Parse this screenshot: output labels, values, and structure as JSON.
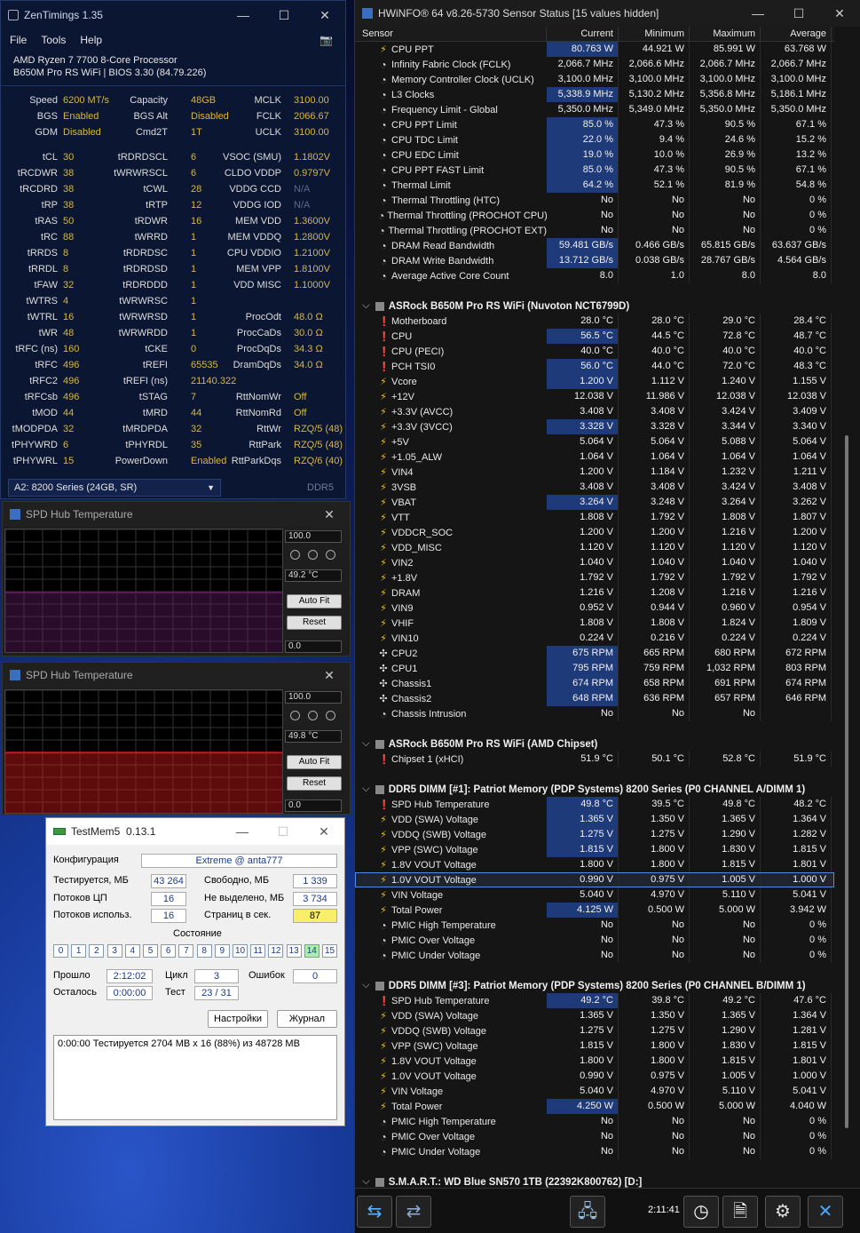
{
  "zt": {
    "title": "ZenTimings 1.35",
    "menu": [
      "File",
      "Tools",
      "Help"
    ],
    "cpu": "AMD Ryzen 7 7700 8-Core Processor",
    "board": "B650M Pro RS WiFi | BIOS 3.30 (84.79.226)",
    "top": [
      [
        "Speed",
        "6200 MT/s",
        "Capacity",
        "48GB",
        "MCLK",
        "3100.00"
      ],
      [
        "BGS",
        "Enabled",
        "BGS Alt",
        "Disabled",
        "FCLK",
        "2066.67"
      ],
      [
        "GDM",
        "Disabled",
        "Cmd2T",
        "1T",
        "UCLK",
        "3100.00"
      ]
    ],
    "timings": [
      [
        "tCL",
        "30",
        "tRDRDSCL",
        "6",
        "VSOC (SMU)",
        "1.1802V"
      ],
      [
        "tRCDWR",
        "38",
        "tWRWRSCL",
        "6",
        "CLDO VDDP",
        "0.9797V"
      ],
      [
        "tRCDRD",
        "38",
        "tCWL",
        "28",
        "VDDG CCD",
        "N/A"
      ],
      [
        "tRP",
        "38",
        "tRTP",
        "12",
        "VDDG IOD",
        "N/A"
      ],
      [
        "tRAS",
        "50",
        "tRDWR",
        "16",
        "MEM VDD",
        "1.3600V"
      ],
      [
        "tRC",
        "88",
        "tWRRD",
        "1",
        "MEM VDDQ",
        "1.2800V"
      ],
      [
        "tRRDS",
        "8",
        "tRDRDSC",
        "1",
        "CPU VDDIO",
        "1.2100V"
      ],
      [
        "tRRDL",
        "8",
        "tRDRDSD",
        "1",
        "MEM VPP",
        "1.8100V"
      ],
      [
        "tFAW",
        "32",
        "tRDRDDD",
        "1",
        "VDD MISC",
        "1.1000V"
      ],
      [
        "tWTRS",
        "4",
        "tWRWRSC",
        "1",
        "",
        ""
      ],
      [
        "tWTRL",
        "16",
        "tWRWRSD",
        "1",
        "ProcOdt",
        "48.0 Ω"
      ],
      [
        "tWR",
        "48",
        "tWRWRDD",
        "1",
        "ProcCaDs",
        "30.0 Ω"
      ],
      [
        "tRFC (ns)",
        "160",
        "tCKE",
        "0",
        "ProcDqDs",
        "34.3 Ω"
      ],
      [
        "tRFC",
        "496",
        "tREFI",
        "65535",
        "DramDqDs",
        "34.0 Ω"
      ],
      [
        "tRFC2",
        "496",
        "tREFI (ns)",
        "21140.322",
        "",
        ""
      ],
      [
        "tRFCsb",
        "496",
        "tSTAG",
        "7",
        "RttNomWr",
        "Off"
      ],
      [
        "tMOD",
        "44",
        "tMRD",
        "44",
        "RttNomRd",
        "Off"
      ],
      [
        "tMODPDA",
        "32",
        "tMRDPDA",
        "32",
        "RttWr",
        "RZQ/5 (48)"
      ],
      [
        "tPHYWRD",
        "6",
        "tPHYRDL",
        "35",
        "RttPark",
        "RZQ/5 (48)"
      ],
      [
        "tPHYWRL",
        "15",
        "PowerDown",
        "Enabled",
        "RttParkDqs",
        "RZQ/6 (40)"
      ]
    ],
    "dimm": "A2: 8200 Series (24GB, SR)",
    "ddr": "DDR5"
  },
  "spd1": {
    "title": "SPD Hub Temperature",
    "max": "100.0",
    "cur": "49.2 °C",
    "min": "0.0",
    "autofit": "Auto Fit",
    "reset": "Reset",
    "level": 0.492
  },
  "spd2": {
    "title": "SPD Hub Temperature",
    "max": "100.0",
    "cur": "49.8 °C",
    "min": "0.0",
    "autofit": "Auto Fit",
    "reset": "Reset",
    "level": 0.498
  },
  "tm": {
    "title": "TestMem5",
    "ver": "0.13.1",
    "cfg_label": "Конфигурация",
    "cfg": "Extreme @ anta777",
    "tested_l": "Тестируется, МБ",
    "tested": "43 264",
    "free_l": "Свободно, МБ",
    "free": "1 339",
    "cpu_l": "Потоков ЦП",
    "cpu": "16",
    "notalloc_l": "Не выделено, МБ",
    "notalloc": "3 734",
    "used_l": "Потоков использ.",
    "used": "16",
    "pages_l": "Страниц в сек.",
    "pages": "87",
    "state": "Состояние",
    "cells": [
      "0",
      "1",
      "2",
      "3",
      "4",
      "5",
      "6",
      "7",
      "8",
      "9",
      "10",
      "11",
      "12",
      "13",
      "14",
      "15"
    ],
    "elapsed_l": "Прошло",
    "elapsed": "2:12:02",
    "cycle_l": "Цикл",
    "cycle": "3",
    "err_l": "Ошибок",
    "err": "0",
    "remain_l": "Осталось",
    "remain": "0:00:00",
    "test_l": "Тест",
    "test": "23 / 31",
    "settings": "Настройки",
    "journal": "Журнал",
    "log": "0:00:00  Тестируется 2704 MB x 16 (88%) из 48728 MB"
  },
  "hw": {
    "title": "HWiNFO® 64 v8.26-5730 Sensor Status [15 values hidden]",
    "cols": [
      "Sensor",
      "Current",
      "Minimum",
      "Maximum",
      "Average"
    ],
    "time": "2:11:41",
    "rows": [
      [
        "r",
        "bolt",
        "CPU PPT",
        "80.763 W",
        "44.921 W",
        "85.991 W",
        "63.768 W",
        1
      ],
      [
        "r",
        "clk",
        "Infinity Fabric Clock (FCLK)",
        "2,066.7 MHz",
        "2,066.6 MHz",
        "2,066.7 MHz",
        "2,066.7 MHz",
        0
      ],
      [
        "r",
        "clk",
        "Memory Controller Clock (UCLK)",
        "3,100.0 MHz",
        "3,100.0 MHz",
        "3,100.0 MHz",
        "3,100.0 MHz",
        0
      ],
      [
        "r",
        "clk",
        "L3 Clocks",
        "5,338.9 MHz",
        "5,130.2 MHz",
        "5,356.8 MHz",
        "5,186.1 MHz",
        1
      ],
      [
        "r",
        "clk",
        "Frequency Limit - Global",
        "5,350.0 MHz",
        "5,349.0 MHz",
        "5,350.0 MHz",
        "5,350.0 MHz",
        0
      ],
      [
        "r",
        "clk",
        "CPU PPT Limit",
        "85.0 %",
        "47.3 %",
        "90.5 %",
        "67.1 %",
        1
      ],
      [
        "r",
        "clk",
        "CPU TDC Limit",
        "22.0 %",
        "9.4 %",
        "24.6 %",
        "15.2 %",
        1
      ],
      [
        "r",
        "clk",
        "CPU EDC Limit",
        "19.0 %",
        "10.0 %",
        "26.9 %",
        "13.2 %",
        1
      ],
      [
        "r",
        "clk",
        "CPU PPT FAST Limit",
        "85.0 %",
        "47.3 %",
        "90.5 %",
        "67.1 %",
        1
      ],
      [
        "r",
        "clk",
        "Thermal Limit",
        "64.2 %",
        "52.1 %",
        "81.9 %",
        "54.8 %",
        1
      ],
      [
        "r",
        "clk",
        "Thermal Throttling (HTC)",
        "No",
        "No",
        "No",
        "0 %",
        0
      ],
      [
        "r",
        "clk",
        "Thermal Throttling (PROCHOT CPU)",
        "No",
        "No",
        "No",
        "0 %",
        0
      ],
      [
        "r",
        "clk",
        "Thermal Throttling (PROCHOT EXT)",
        "No",
        "No",
        "No",
        "0 %",
        0
      ],
      [
        "r",
        "clk",
        "DRAM Read Bandwidth",
        "59.481 GB/s",
        "0.466 GB/s",
        "65.815 GB/s",
        "63.637 GB/s",
        1
      ],
      [
        "r",
        "clk",
        "DRAM Write Bandwidth",
        "13.712 GB/s",
        "0.038 GB/s",
        "28.767 GB/s",
        "4.564 GB/s",
        1
      ],
      [
        "r",
        "clk",
        "Average Active Core Count",
        "8.0",
        "1.0",
        "8.0",
        "8.0",
        0
      ],
      [
        "gap"
      ],
      [
        "g",
        "ASRock B650M Pro RS WiFi (Nuvoton NCT6799D)"
      ],
      [
        "r",
        "th",
        "Motherboard",
        "28.0 °C",
        "28.0 °C",
        "29.0 °C",
        "28.4 °C",
        0
      ],
      [
        "r",
        "th",
        "CPU",
        "56.5 °C",
        "44.5 °C",
        "72.8 °C",
        "48.7 °C",
        1
      ],
      [
        "r",
        "th",
        "CPU (PECI)",
        "40.0 °C",
        "40.0 °C",
        "40.0 °C",
        "40.0 °C",
        0
      ],
      [
        "r",
        "th",
        "PCH TSI0",
        "56.0 °C",
        "44.0 °C",
        "72.0 °C",
        "48.3 °C",
        1
      ],
      [
        "r",
        "bolt",
        "Vcore",
        "1.200 V",
        "1.112 V",
        "1.240 V",
        "1.155 V",
        1
      ],
      [
        "r",
        "bolt",
        "+12V",
        "12.038 V",
        "11.986 V",
        "12.038 V",
        "12.038 V",
        0
      ],
      [
        "r",
        "bolt",
        "+3.3V (AVCC)",
        "3.408 V",
        "3.408 V",
        "3.424 V",
        "3.409 V",
        0
      ],
      [
        "r",
        "bolt",
        "+3.3V (3VCC)",
        "3.328 V",
        "3.328 V",
        "3.344 V",
        "3.340 V",
        1
      ],
      [
        "r",
        "bolt",
        "+5V",
        "5.064 V",
        "5.064 V",
        "5.088 V",
        "5.064 V",
        0
      ],
      [
        "r",
        "bolt",
        "+1.05_ALW",
        "1.064 V",
        "1.064 V",
        "1.064 V",
        "1.064 V",
        0
      ],
      [
        "r",
        "bolt",
        "VIN4",
        "1.200 V",
        "1.184 V",
        "1.232 V",
        "1.211 V",
        0
      ],
      [
        "r",
        "bolt",
        "3VSB",
        "3.408 V",
        "3.408 V",
        "3.424 V",
        "3.408 V",
        0
      ],
      [
        "r",
        "bolt",
        "VBAT",
        "3.264 V",
        "3.248 V",
        "3.264 V",
        "3.262 V",
        1
      ],
      [
        "r",
        "bolt",
        "VTT",
        "1.808 V",
        "1.792 V",
        "1.808 V",
        "1.807 V",
        0
      ],
      [
        "r",
        "bolt",
        "VDDCR_SOC",
        "1.200 V",
        "1.200 V",
        "1.216 V",
        "1.200 V",
        0
      ],
      [
        "r",
        "bolt",
        "VDD_MISC",
        "1.120 V",
        "1.120 V",
        "1.120 V",
        "1.120 V",
        0
      ],
      [
        "r",
        "bolt",
        "VIN2",
        "1.040 V",
        "1.040 V",
        "1.040 V",
        "1.040 V",
        0
      ],
      [
        "r",
        "bolt",
        "+1.8V",
        "1.792 V",
        "1.792 V",
        "1.792 V",
        "1.792 V",
        0
      ],
      [
        "r",
        "bolt",
        "DRAM",
        "1.216 V",
        "1.208 V",
        "1.216 V",
        "1.216 V",
        0
      ],
      [
        "r",
        "bolt",
        "VIN9",
        "0.952 V",
        "0.944 V",
        "0.960 V",
        "0.954 V",
        0
      ],
      [
        "r",
        "bolt",
        "VHIF",
        "1.808 V",
        "1.808 V",
        "1.824 V",
        "1.809 V",
        0
      ],
      [
        "r",
        "bolt",
        "VIN10",
        "0.224 V",
        "0.216 V",
        "0.224 V",
        "0.224 V",
        0
      ],
      [
        "r",
        "fan",
        "CPU2",
        "675 RPM",
        "665 RPM",
        "680 RPM",
        "672 RPM",
        1
      ],
      [
        "r",
        "fan",
        "CPU1",
        "795 RPM",
        "759 RPM",
        "1,032 RPM",
        "803 RPM",
        1
      ],
      [
        "r",
        "fan",
        "Chassis1",
        "674 RPM",
        "658 RPM",
        "691 RPM",
        "674 RPM",
        1
      ],
      [
        "r",
        "fan",
        "Chassis2",
        "648 RPM",
        "636 RPM",
        "657 RPM",
        "646 RPM",
        1
      ],
      [
        "r",
        "clk",
        "Chassis Intrusion",
        "No",
        "No",
        "No",
        "",
        0
      ],
      [
        "gap"
      ],
      [
        "g",
        "ASRock B650M Pro RS WiFi (AMD Chipset)"
      ],
      [
        "r",
        "th",
        "Chipset 1 (xHCI)",
        "51.9 °C",
        "50.1 °C",
        "52.8 °C",
        "51.9 °C",
        0
      ],
      [
        "gap"
      ],
      [
        "g",
        "DDR5 DIMM [#1]: Patriot Memory (PDP Systems) 8200 Series (P0 CHANNEL A/DIMM 1)"
      ],
      [
        "r",
        "th",
        "SPD Hub Temperature",
        "49.8 °C",
        "39.5 °C",
        "49.8 °C",
        "48.2 °C",
        1
      ],
      [
        "r",
        "bolt",
        "VDD (SWA) Voltage",
        "1.365 V",
        "1.350 V",
        "1.365 V",
        "1.364 V",
        1
      ],
      [
        "r",
        "bolt",
        "VDDQ (SWB) Voltage",
        "1.275 V",
        "1.275 V",
        "1.290 V",
        "1.282 V",
        1
      ],
      [
        "r",
        "bolt",
        "VPP (SWC) Voltage",
        "1.815 V",
        "1.800 V",
        "1.830 V",
        "1.815 V",
        1
      ],
      [
        "r",
        "bolt",
        "1.8V VOUT Voltage",
        "1.800 V",
        "1.800 V",
        "1.815 V",
        "1.801 V",
        0
      ],
      [
        "s",
        "bolt",
        "1.0V VOUT Voltage",
        "0.990 V",
        "0.975 V",
        "1.005 V",
        "1.000 V",
        0
      ],
      [
        "r",
        "bolt",
        "VIN Voltage",
        "5.040 V",
        "4.970 V",
        "5.110 V",
        "5.041 V",
        0
      ],
      [
        "r",
        "bolt",
        "Total Power",
        "4.125 W",
        "0.500 W",
        "5.000 W",
        "3.942 W",
        1
      ],
      [
        "r",
        "clk",
        "PMIC High Temperature",
        "No",
        "No",
        "No",
        "0 %",
        0
      ],
      [
        "r",
        "clk",
        "PMIC Over Voltage",
        "No",
        "No",
        "No",
        "0 %",
        0
      ],
      [
        "r",
        "clk",
        "PMIC Under Voltage",
        "No",
        "No",
        "No",
        "0 %",
        0
      ],
      [
        "gap"
      ],
      [
        "g",
        "DDR5 DIMM [#3]: Patriot Memory (PDP Systems) 8200 Series (P0 CHANNEL B/DIMM 1)"
      ],
      [
        "r",
        "th",
        "SPD Hub Temperature",
        "49.2 °C",
        "39.8 °C",
        "49.2 °C",
        "47.6 °C",
        1
      ],
      [
        "r",
        "bolt",
        "VDD (SWA) Voltage",
        "1.365 V",
        "1.350 V",
        "1.365 V",
        "1.364 V",
        0
      ],
      [
        "r",
        "bolt",
        "VDDQ (SWB) Voltage",
        "1.275 V",
        "1.275 V",
        "1.290 V",
        "1.281 V",
        0
      ],
      [
        "r",
        "bolt",
        "VPP (SWC) Voltage",
        "1.815 V",
        "1.800 V",
        "1.830 V",
        "1.815 V",
        0
      ],
      [
        "r",
        "bolt",
        "1.8V VOUT Voltage",
        "1.800 V",
        "1.800 V",
        "1.815 V",
        "1.801 V",
        0
      ],
      [
        "r",
        "bolt",
        "1.0V VOUT Voltage",
        "0.990 V",
        "0.975 V",
        "1.005 V",
        "1.000 V",
        0
      ],
      [
        "r",
        "bolt",
        "VIN Voltage",
        "5.040 V",
        "4.970 V",
        "5.110 V",
        "5.041 V",
        0
      ],
      [
        "r",
        "bolt",
        "Total Power",
        "4.250 W",
        "0.500 W",
        "5.000 W",
        "4.040 W",
        1
      ],
      [
        "r",
        "clk",
        "PMIC High Temperature",
        "No",
        "No",
        "No",
        "0 %",
        0
      ],
      [
        "r",
        "clk",
        "PMIC Over Voltage",
        "No",
        "No",
        "No",
        "0 %",
        0
      ],
      [
        "r",
        "clk",
        "PMIC Under Voltage",
        "No",
        "No",
        "No",
        "0 %",
        0
      ],
      [
        "gap"
      ],
      [
        "g",
        "S.M.A.R.T.: WD Blue SN570 1TB (22392K800762) [D:]"
      ]
    ]
  }
}
